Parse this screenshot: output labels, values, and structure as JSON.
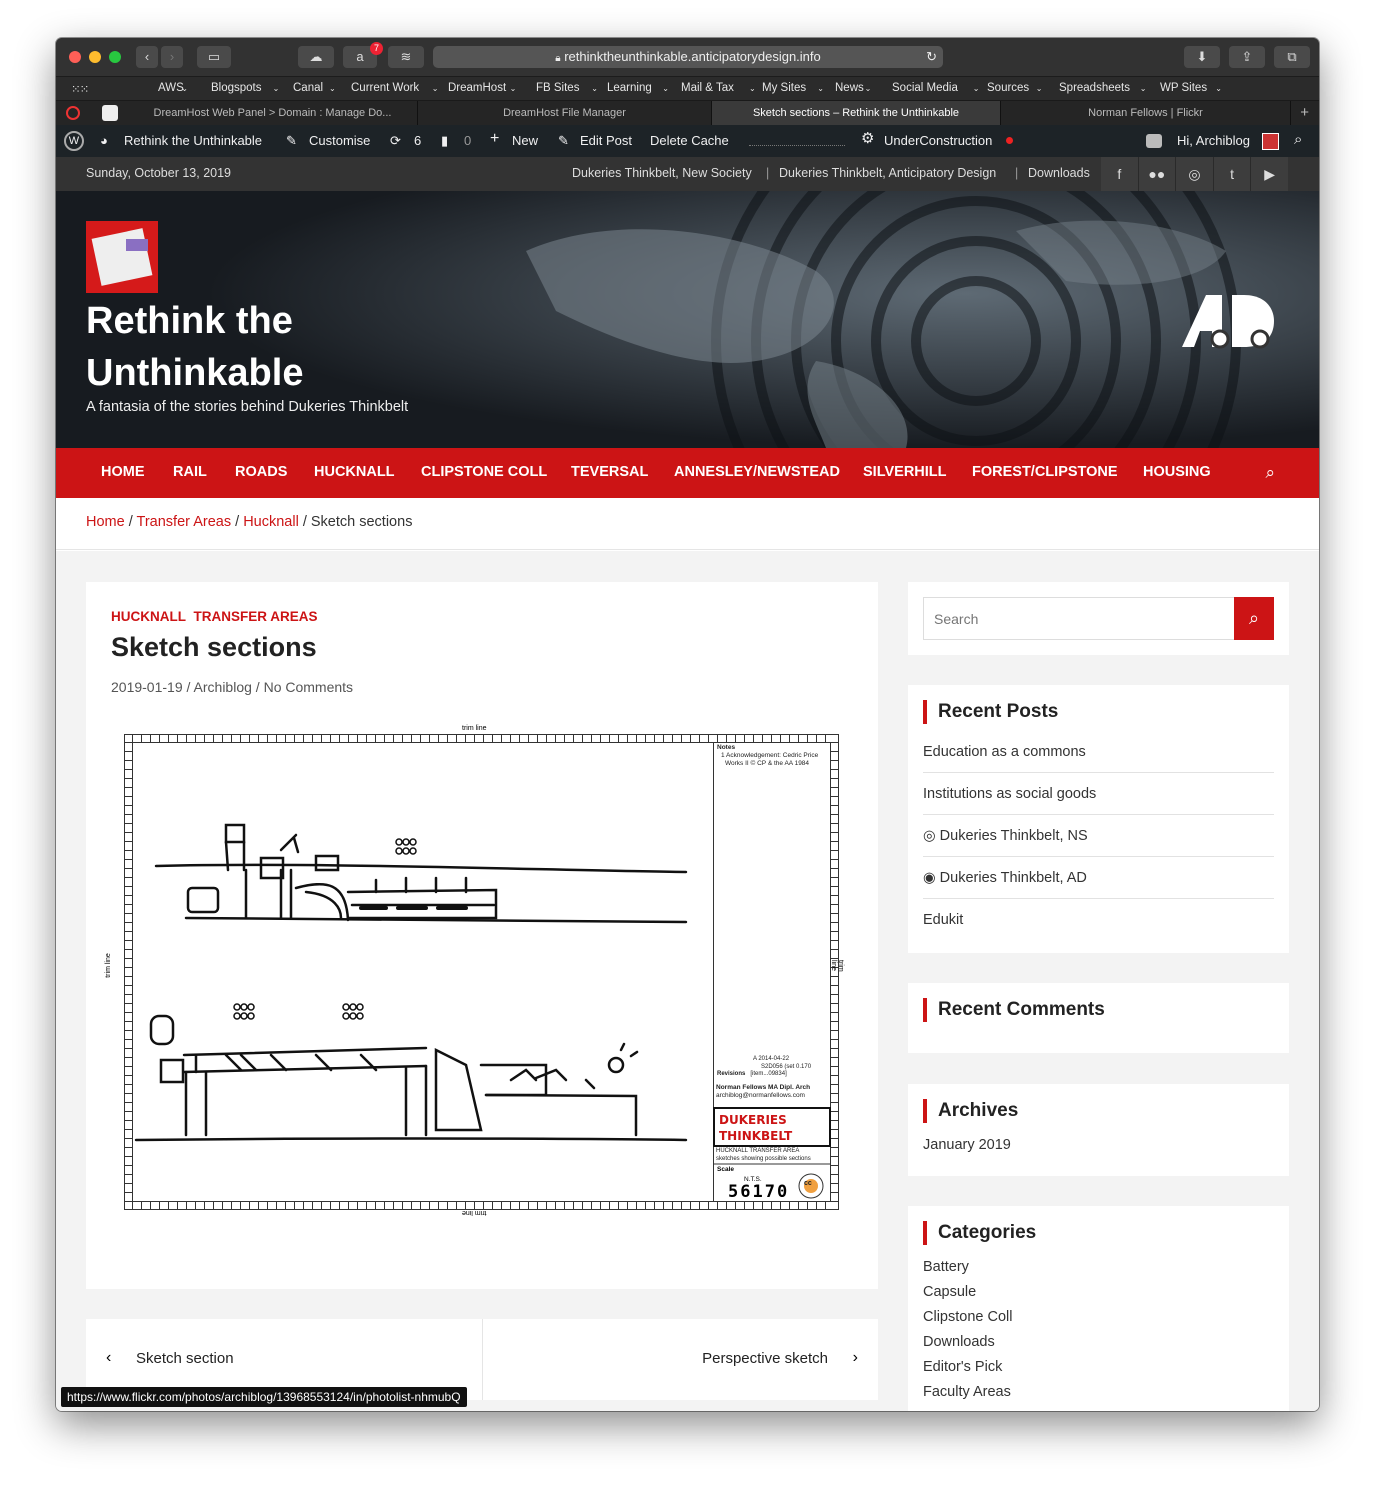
{
  "browser": {
    "url": "rethinktheunthinkable.anticipatorydesign.info",
    "badge": "7",
    "bookmarks": [
      "AWS",
      "Blogspots",
      "Canal",
      "Current Work",
      "DreamHost",
      "FB Sites",
      "Learning",
      "Mail & Tax",
      "My Sites",
      "News",
      "Social Media",
      "Sources",
      "Spreadsheets",
      "WP Sites"
    ],
    "tabs": [
      "DreamHost Web Panel > Domain : Manage Do...",
      "DreamHost File Manager",
      "Sketch sections – Rethink the Unthinkable",
      "Norman Fellows | Flickr"
    ],
    "status_url": "https://www.flickr.com/photos/archiblog/13968553124/in/photolist-nhmubQ"
  },
  "wpbar": {
    "site": "Rethink the Unthinkable",
    "customise": "Customise",
    "updates": "6",
    "comments": "0",
    "new": "New",
    "edit": "Edit Post",
    "cache": "Delete Cache",
    "plugin": "UnderConstruction",
    "greeting": "Hi, Archiblog"
  },
  "topbar": {
    "date": "Sunday, October 13, 2019",
    "links": [
      "Dukeries Thinkbelt, New Society",
      "Dukeries Thinkbelt, Anticipatory Design",
      "Downloads"
    ],
    "sep": "|"
  },
  "site": {
    "title_line1": "Rethink the",
    "title_line2": "Unthinkable",
    "tagline": "A fantasia of the stories behind Dukeries Thinkbelt"
  },
  "nav": [
    "HOME",
    "RAIL",
    "ROADS",
    "HUCKNALL",
    "CLIPSTONE COLL",
    "TEVERSAL",
    "ANNESLEY/NEWSTEAD",
    "SILVERHILL",
    "FOREST/CLIPSTONE",
    "HOUSING"
  ],
  "breadcrumb": {
    "items": [
      "Home",
      "Transfer Areas",
      "Hucknall"
    ],
    "current": "Sketch sections",
    "sep": "/"
  },
  "post": {
    "cats": [
      "HUCKNALL",
      "TRANSFER AREAS"
    ],
    "title": "Sketch sections",
    "date": "2019-01-19",
    "author": "Archiblog",
    "comments": "No Comments",
    "sep": "/"
  },
  "drawing": {
    "trim": "trim line",
    "notes_title": "Notes",
    "note1a": "1 Acknowledgement: Cedric Price",
    "note1b": "Works II © CP & the AA 1984",
    "rev1": "A 2014-04-22",
    "rev2": "S2D056 (set 0.170",
    "rev_label": "Revisions",
    "rev3": "[item...09834]",
    "author": "Norman Fellows MA Dipl. Arch",
    "email": "archiblog@normanfellows.com",
    "brand1": "DUKERIES",
    "brand2": "THINKBELT",
    "desc1": "HUCKNALL TRANSFER AREA",
    "desc2": "sketches showing possible sections",
    "scale_label": "Scale",
    "scale": "N.T.S.",
    "number": "56170",
    "cc": "cc"
  },
  "postnav": {
    "prev": "Sketch section",
    "next": "Perspective sketch"
  },
  "sidebar": {
    "search_placeholder": "Search",
    "recent_posts_title": "Recent Posts",
    "recent_posts": [
      "Education as a commons",
      "Institutions as social goods",
      "◎ Dukeries Thinkbelt, NS",
      "◉ Dukeries Thinkbelt, AD",
      "Edukit"
    ],
    "recent_comments_title": "Recent Comments",
    "archives_title": "Archives",
    "archives": [
      "January 2019"
    ],
    "categories_title": "Categories",
    "categories": [
      "Battery",
      "Capsule",
      "Clipstone Coll",
      "Downloads",
      "Editor's Pick",
      "Faculty Areas"
    ]
  },
  "colors": {
    "accent": "#cc1415"
  }
}
